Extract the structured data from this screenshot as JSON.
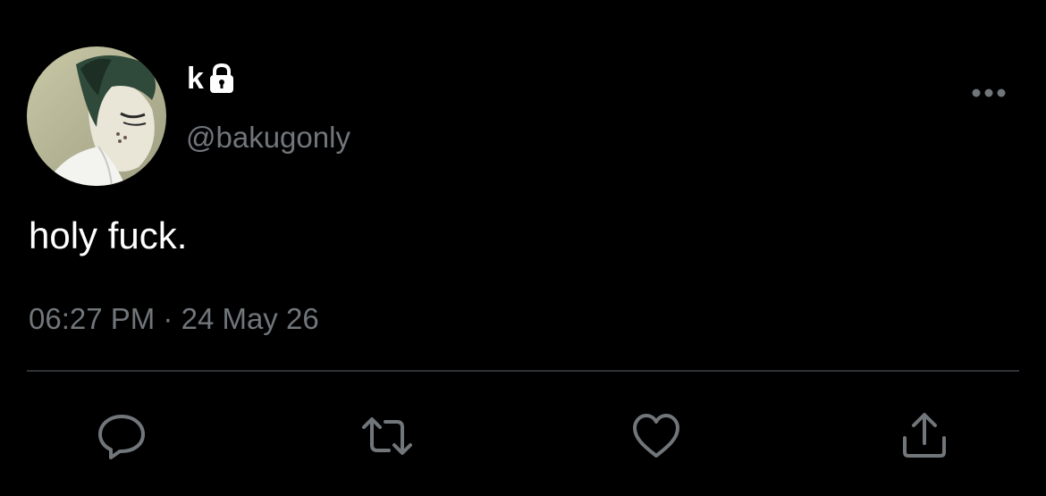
{
  "user": {
    "display_name": "k",
    "handle": "@bakugonly",
    "protected_icon": "lock-icon",
    "avatar": "profile-avatar"
  },
  "tweet": {
    "text": "holy fuck.",
    "time": "06:27 PM",
    "separator": "·",
    "date": "24 May 26"
  },
  "actions": [
    {
      "name": "reply",
      "icon": "reply-icon"
    },
    {
      "name": "retweet",
      "icon": "retweet-icon"
    },
    {
      "name": "like",
      "icon": "heart-icon"
    },
    {
      "name": "share",
      "icon": "share-icon"
    }
  ],
  "colors": {
    "background": "#000000",
    "primary_text": "#ffffff",
    "secondary_text": "#71767b",
    "divider": "#2f3336"
  }
}
